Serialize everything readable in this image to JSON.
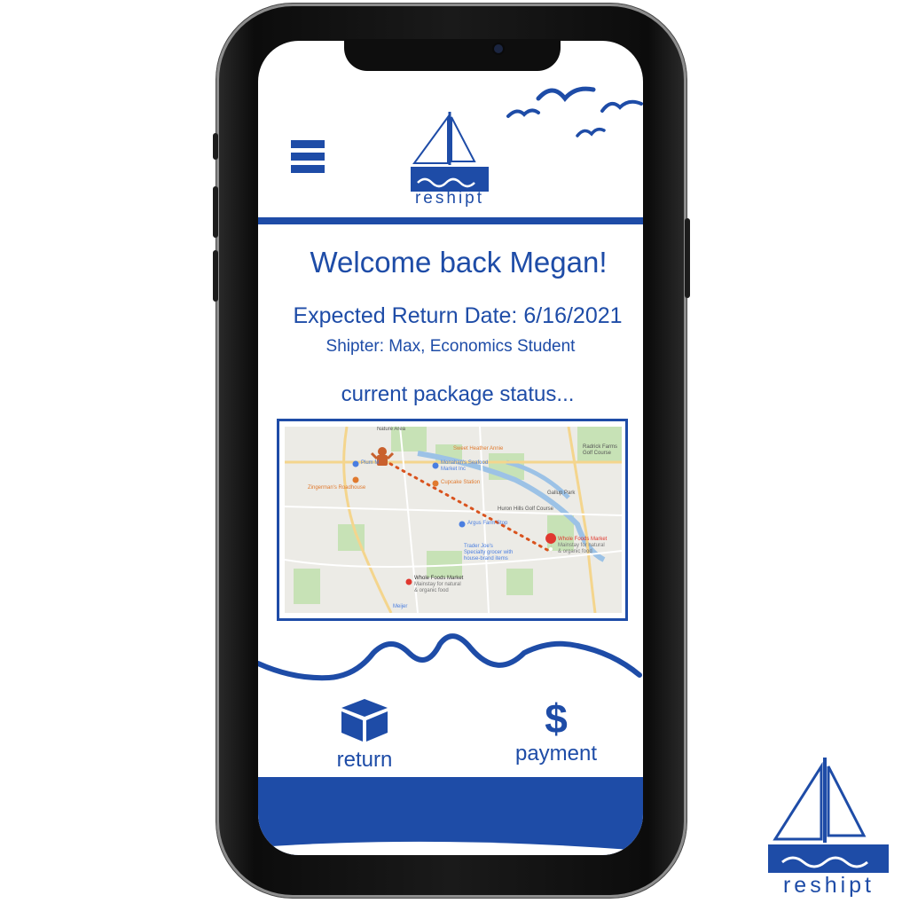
{
  "app": {
    "name": "reshipt"
  },
  "header": {
    "menu_icon": "hamburger-menu-icon",
    "logo_text": "reshipt"
  },
  "main": {
    "welcome": "Welcome back Megan!",
    "expected_return": "Expected Return Date: 6/16/2021",
    "shipter": "Shipter: Max, Economics Student",
    "status_heading": "current package status..."
  },
  "map": {
    "places": [
      "Nature Area",
      "Sweet Heather Annie",
      "Plum M",
      "Monahan's Seafood",
      "Market Inc",
      "Zingerman's Roadhouse",
      "Cupcake Station",
      "Radrick Farms",
      "Golf Course",
      "Gallup Park",
      "Huron Hills Golf Course",
      "Argus Farm Stop",
      "Trader Joe's",
      "Specialty grocer with",
      "house-brand items",
      "Whole Foods Market",
      "Mainstay for natural",
      "& organic food",
      "Meijer"
    ]
  },
  "actions": {
    "return_label": "return",
    "return_icon": "box-icon",
    "payment_label": "payment",
    "payment_icon": "dollar-icon"
  },
  "branding": {
    "corner_logo_text": "reshipt"
  },
  "colors": {
    "brand_blue": "#1e4ca7",
    "route_orange": "#d9531e"
  }
}
